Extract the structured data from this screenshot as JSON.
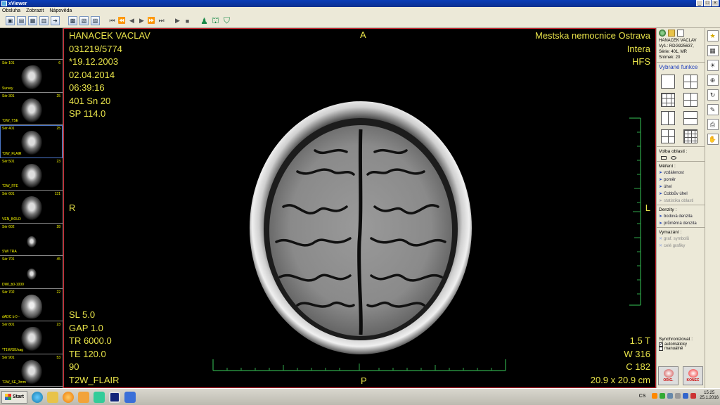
{
  "window": {
    "title": "xViewer"
  },
  "menu": [
    "Obsluha",
    "Zobrazit",
    "Nápověda"
  ],
  "series": [
    {
      "label": "Sér 101",
      "count": "6",
      "desc": "Survey"
    },
    {
      "label": "Sér 301",
      "count": "25",
      "desc": "T2W_TSE"
    },
    {
      "label": "Sér 401",
      "count": "25",
      "desc": "T2W_FLAIR"
    },
    {
      "label": "Sér 501",
      "count": "23",
      "desc": "T2W_FFE"
    },
    {
      "label": "Sér 601",
      "count": "131",
      "desc": "VEN_BOLD"
    },
    {
      "label": "Sér 602",
      "count": "28",
      "desc": "SWI TRA"
    },
    {
      "label": "Sér 701",
      "count": "45",
      "desc": "DWI_b0-1000"
    },
    {
      "label": "Sér 702",
      "count": "22",
      "desc": "dADC b 0 -"
    },
    {
      "label": "Sér 801",
      "count": "23",
      "desc": "*T1W/SE/sag"
    },
    {
      "label": "Sér 901",
      "count": "53",
      "desc": "T2W_SE_3mm"
    }
  ],
  "overlay": {
    "patient_name": "HANACEK VACLAV",
    "patient_id": "031219/5774",
    "birth_date": "*19.12.2003",
    "study_date": "02.04.2014",
    "study_time": "06:39:16",
    "series_slice": "401 Sn 20",
    "slice_position": "SP 114.0",
    "hospital": "Mestska nemocnice Ostrava",
    "scanner": "Intera",
    "patient_position": "HFS",
    "slice_thickness": "SL 5.0",
    "gap": "GAP 1.0",
    "tr": "TR 6000.0",
    "te": "TE 120.0",
    "flip": "90",
    "protocol": "T2W_FLAIR",
    "field_strength": "1.5 T",
    "window_width": "W 316",
    "window_center": "C 182",
    "fov": "20.9 x 20.9 cm",
    "orient_top": "A",
    "orient_bottom": "P",
    "orient_left": "R",
    "orient_right": "L"
  },
  "info_panel": {
    "name": "HANACEK VACLAV",
    "exam": "Vyš.:      RDG925637,",
    "series": "Série:      401, MR",
    "image": "Snímek:  20"
  },
  "tools": {
    "title": "Vybrané funkce",
    "region_label": "Volba oblasti :",
    "measure_label": "Měření :",
    "measure_items": [
      "vzdálenost",
      "poměr",
      "úhel",
      "Cobbův úhel"
    ],
    "measure_disabled": "statistika oblasti",
    "density_label": "Denzity :",
    "density_items": [
      "bodová denzita",
      "průměrná denzita"
    ],
    "delete_label": "Vymazání :",
    "delete_items": [
      "graf. symbolů",
      "celé grafiky"
    ],
    "sync_label": "Synchronizovat :",
    "sync_auto": "automaticky",
    "sync_manual": "manuálně",
    "orig_button": "ORIG.",
    "end_button": "KONEC"
  },
  "taskbar": {
    "start": "Start",
    "lang": "CS",
    "time": "15:25",
    "date": "25.1.2016"
  },
  "colors": {
    "overlay_text": "#e8e34a",
    "viewer_border": "#c8262f",
    "scale_green": "#2fa84a"
  }
}
